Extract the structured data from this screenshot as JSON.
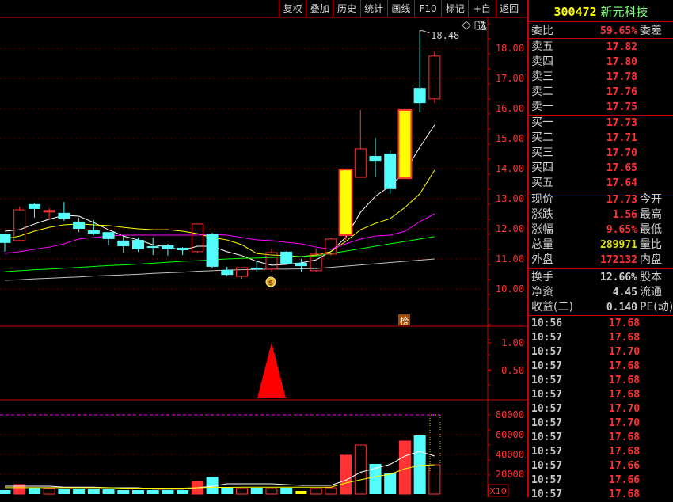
{
  "toolbar": [
    "复权",
    "叠加",
    "历史",
    "统计",
    "画线",
    "F10",
    "标记",
    "+自选",
    "返回"
  ],
  "stock": {
    "code": "300472",
    "name": "新元科技"
  },
  "colors": {
    "up": "#ff3333",
    "down": "#54fcfc",
    "limit": "#ffff00",
    "ma5": "#ffffff",
    "ma10": "#ffff00",
    "ma20": "#ff00ff",
    "ma30": "#00ff00",
    "ma60": "#c0c0c0",
    "grid": "#8a0000",
    "axis": "#ff3333"
  },
  "icons": {
    "diamond": "diamond-icon",
    "panel": "panel-toggle-icon",
    "money": "money-bag-icon",
    "flag": "flag-icon"
  },
  "main_chart": {
    "high_label": "18.48",
    "badge": "榜",
    "price_axis": [
      "18.00",
      "17.00",
      "16.00",
      "15.00",
      "14.00",
      "13.00",
      "12.00",
      "11.00",
      "10.00"
    ],
    "candles": [
      [
        11.82,
        11.82,
        11.24,
        11.53
      ],
      [
        11.61,
        12.74,
        11.61,
        12.63
      ],
      [
        12.82,
        12.87,
        12.37,
        12.66
      ],
      [
        12.61,
        12.68,
        12.32,
        12.61
      ],
      [
        12.53,
        12.89,
        12.26,
        12.34
      ],
      [
        12.24,
        12.37,
        11.89,
        12.0
      ],
      [
        11.95,
        12.29,
        11.79,
        11.84
      ],
      [
        11.89,
        11.89,
        11.45,
        11.66
      ],
      [
        11.61,
        11.76,
        11.21,
        11.42
      ],
      [
        11.63,
        11.71,
        11.24,
        11.32
      ],
      [
        11.42,
        11.71,
        11.13,
        11.42
      ],
      [
        11.45,
        11.5,
        11.11,
        11.32
      ],
      [
        11.37,
        11.39,
        11.13,
        11.29
      ],
      [
        11.24,
        12.16,
        11.18,
        12.16
      ],
      [
        11.82,
        11.87,
        10.68,
        10.74
      ],
      [
        10.63,
        10.74,
        10.42,
        10.47
      ],
      [
        10.42,
        10.71,
        10.34,
        10.71
      ],
      [
        10.71,
        10.92,
        10.58,
        10.66
      ],
      [
        10.66,
        11.34,
        10.58,
        11.21
      ],
      [
        11.24,
        11.26,
        10.84,
        10.84
      ],
      [
        10.87,
        11.0,
        10.58,
        10.76
      ],
      [
        10.61,
        11.34,
        10.58,
        11.16
      ],
      [
        11.16,
        11.71,
        11.11,
        11.66
      ],
      [
        11.79,
        13.97,
        11.63,
        13.97
      ],
      [
        13.71,
        15.95,
        13.71,
        14.66
      ],
      [
        14.42,
        15.03,
        13.71,
        14.26
      ],
      [
        14.5,
        14.61,
        13.16,
        13.32
      ],
      [
        13.68,
        15.95,
        13.68,
        15.95
      ],
      [
        16.68,
        18.48,
        15.87,
        16.18
      ],
      [
        16.32,
        17.89,
        16.18,
        17.74
      ]
    ],
    "limit_up": [
      24,
      28
    ],
    "ma": {
      "ma5": [
        11.92,
        11.97,
        12.16,
        12.32,
        12.45,
        12.42,
        12.21,
        11.97,
        11.76,
        11.63,
        11.47,
        11.39,
        11.29,
        11.42,
        11.42,
        11.24,
        11.11,
        10.92,
        10.79,
        10.82,
        10.87,
        10.97,
        11.24,
        11.71,
        12.55,
        13.08,
        13.42,
        13.89,
        14.71,
        15.45
      ],
      "ma10": [
        11.66,
        11.76,
        11.92,
        12.05,
        12.13,
        12.16,
        12.13,
        12.11,
        12.05,
        12.0,
        11.97,
        11.97,
        11.92,
        11.84,
        11.71,
        11.63,
        11.47,
        11.18,
        11.13,
        11.11,
        11.08,
        11.13,
        11.24,
        11.58,
        11.97,
        12.18,
        12.34,
        12.71,
        13.16,
        13.95
      ],
      "ma20": [
        11.18,
        11.24,
        11.32,
        11.39,
        11.5,
        11.66,
        11.71,
        11.76,
        11.79,
        11.79,
        11.79,
        11.79,
        11.79,
        11.79,
        11.82,
        11.79,
        11.71,
        11.63,
        11.61,
        11.55,
        11.5,
        11.39,
        11.32,
        11.5,
        11.66,
        11.76,
        11.79,
        11.92,
        12.24,
        12.5
      ],
      "ma30": [
        10.58,
        10.61,
        10.64,
        10.66,
        10.69,
        10.72,
        10.75,
        10.78,
        10.8,
        10.83,
        10.86,
        10.89,
        10.92,
        10.94,
        10.97,
        11.0,
        11.02,
        11.03,
        11.05,
        11.07,
        11.08,
        11.1,
        11.18,
        11.26,
        11.34,
        11.42,
        11.5,
        11.58,
        11.66,
        11.74
      ],
      "ma60": [
        10.29,
        10.31,
        10.34,
        10.36,
        10.38,
        10.4,
        10.43,
        10.45,
        10.47,
        10.49,
        10.52,
        10.54,
        10.56,
        10.59,
        10.61,
        10.63,
        10.64,
        10.65,
        10.66,
        10.66,
        10.67,
        10.68,
        10.72,
        10.76,
        10.8,
        10.84,
        10.88,
        10.92,
        10.96,
        11.0
      ]
    }
  },
  "indicator": {
    "axis": [
      "1.00",
      "0.50"
    ],
    "values": [
      0,
      0,
      0,
      0,
      0,
      0,
      0,
      0,
      0,
      0,
      0,
      0,
      0,
      0,
      0,
      0,
      0,
      0,
      1,
      0,
      0,
      0,
      0,
      0,
      0,
      0,
      0,
      0,
      0,
      0
    ]
  },
  "volume": {
    "axis": [
      "80000",
      "60000",
      "40000",
      "20000"
    ],
    "unit": "X10",
    "values": [
      4000,
      9600,
      6400,
      5600,
      5600,
      5600,
      5600,
      4800,
      4000,
      4000,
      4000,
      4000,
      4000,
      12800,
      17600,
      6400,
      5600,
      6400,
      5600,
      6400,
      3200,
      5600,
      6400,
      39200,
      49600,
      30400,
      20800,
      53600,
      59200,
      29600
    ],
    "ma5": [
      8000,
      8000,
      8000,
      8000,
      7000,
      7000,
      7000,
      6400,
      6400,
      6400,
      5000,
      5000,
      5000,
      6400,
      8000,
      10400,
      10400,
      10400,
      10400,
      9600,
      8800,
      8800,
      8800,
      14000,
      22000,
      26000,
      30000,
      38400,
      43200,
      38400
    ],
    "ma10": [
      6500,
      6500,
      6500,
      6500,
      6500,
      6500,
      6500,
      6500,
      6000,
      6000,
      6000,
      6000,
      6000,
      6400,
      6800,
      6800,
      7000,
      7000,
      7000,
      7000,
      7000,
      7000,
      7000,
      11200,
      14400,
      17600,
      20000,
      25600,
      28800,
      29600
    ]
  },
  "panel": {
    "wb": {
      "label": "委比",
      "value": "59.65%",
      "label2": "委差"
    },
    "sell": [
      {
        "label": "卖五",
        "price": "17.82"
      },
      {
        "label": "卖四",
        "price": "17.80"
      },
      {
        "label": "卖三",
        "price": "17.78"
      },
      {
        "label": "卖二",
        "price": "17.76"
      },
      {
        "label": "卖一",
        "price": "17.75"
      }
    ],
    "buy": [
      {
        "label": "买一",
        "price": "17.73"
      },
      {
        "label": "买二",
        "price": "17.71"
      },
      {
        "label": "买三",
        "price": "17.70"
      },
      {
        "label": "买四",
        "price": "17.65"
      },
      {
        "label": "买五",
        "price": "17.64"
      }
    ],
    "quote": [
      {
        "label": "现价",
        "value": "17.73",
        "label2": "今开",
        "color": "#ff3333"
      },
      {
        "label": "涨跌",
        "value": "1.56",
        "label2": "最高",
        "color": "#ff3333"
      },
      {
        "label": "涨幅",
        "value": "9.65%",
        "label2": "最低",
        "color": "#ff3333"
      },
      {
        "label": "总量",
        "value": "289971",
        "label2": "量比",
        "color": "#e0e000"
      },
      {
        "label": "外盘",
        "value": "172132",
        "label2": "内盘",
        "color": "#ff3333"
      }
    ],
    "fund": [
      {
        "label": "换手",
        "value": "12.66%",
        "label2": "股本"
      },
      {
        "label": "净资",
        "value": "4.45",
        "label2": "流通"
      },
      {
        "label": "收益(二)",
        "value": "0.140",
        "label2": "PE(动)"
      }
    ],
    "ticks": [
      {
        "t": "10:56",
        "p": "17.68"
      },
      {
        "t": "10:57",
        "p": "17.68"
      },
      {
        "t": "10:57",
        "p": "17.70"
      },
      {
        "t": "10:57",
        "p": "17.68"
      },
      {
        "t": "10:57",
        "p": "17.68"
      },
      {
        "t": "10:57",
        "p": "17.68"
      },
      {
        "t": "10:57",
        "p": "17.70"
      },
      {
        "t": "10:57",
        "p": "17.70"
      },
      {
        "t": "10:57",
        "p": "17.68"
      },
      {
        "t": "10:57",
        "p": "17.68"
      },
      {
        "t": "10:57",
        "p": "17.66"
      },
      {
        "t": "10:57",
        "p": "17.66"
      },
      {
        "t": "10:57",
        "p": "17.68"
      }
    ]
  }
}
